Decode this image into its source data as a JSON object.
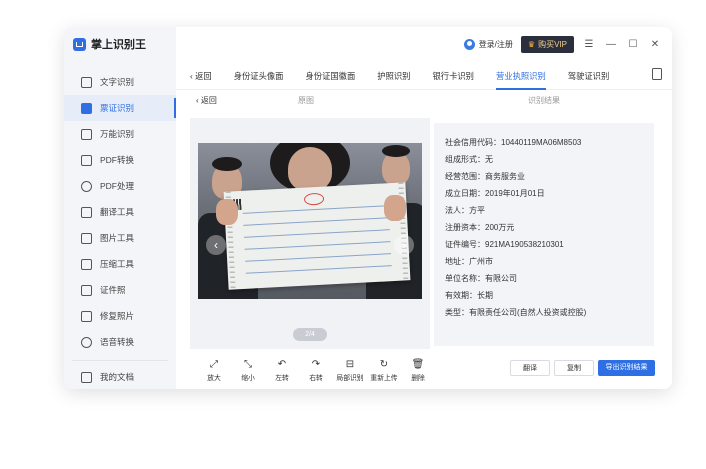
{
  "app": {
    "title": "掌上识别王"
  },
  "sidebar": {
    "items": [
      {
        "label": "文字识别",
        "icon": "text-doc-icon"
      },
      {
        "label": "票证识别",
        "icon": "card-icon"
      },
      {
        "label": "万能识别",
        "icon": "scan-icon"
      },
      {
        "label": "PDF转换",
        "icon": "pdf-convert-icon"
      },
      {
        "label": "PDF处理",
        "icon": "pdf-process-icon"
      },
      {
        "label": "翻译工具",
        "icon": "translate-icon"
      },
      {
        "label": "图片工具",
        "icon": "image-icon"
      },
      {
        "label": "压缩工具",
        "icon": "compress-icon"
      },
      {
        "label": "证件照",
        "icon": "id-photo-icon"
      },
      {
        "label": "修复照片",
        "icon": "repair-photo-icon"
      },
      {
        "label": "语音转换",
        "icon": "voice-icon"
      }
    ],
    "bottom": {
      "label": "我的文档",
      "icon": "my-docs-icon"
    }
  },
  "titlebar": {
    "login": "登录/注册",
    "vip": "购买VIP",
    "menu": "☰",
    "minimize": "—",
    "maximize": "☐",
    "close": "✕"
  },
  "tabs": {
    "back": "返回",
    "items": [
      "身份证头像面",
      "身份证国徽面",
      "护照识别",
      "银行卡识别",
      "营业执照识别",
      "驾驶证识别"
    ],
    "active_index": 4
  },
  "subheader": {
    "back": "返回",
    "original": "原图",
    "result": "识别结果"
  },
  "image": {
    "pager": "2/4",
    "prev": "‹",
    "next": "›"
  },
  "result": {
    "fields": [
      "社会信用代码：10440119MA06M8503",
      "组成形式：无",
      "经营范围：商务服务业",
      "成立日期：2019年01月01日",
      "法人：方平",
      "注册资本：200万元",
      "证件编号：921MA190538210301",
      "地址：广州市",
      "单位名称：有限公司",
      "有效期：长期",
      "类型：有限责任公司(自然人投资或控股)"
    ]
  },
  "toolbar": {
    "tools": [
      {
        "label": "放大",
        "glyph": "⤢",
        "icon": "zoom-in-icon"
      },
      {
        "label": "缩小",
        "glyph": "⤡",
        "icon": "zoom-out-icon"
      },
      {
        "label": "左转",
        "glyph": "↶",
        "icon": "rotate-left-icon"
      },
      {
        "label": "右转",
        "glyph": "↷",
        "icon": "rotate-right-icon"
      },
      {
        "label": "局部识别",
        "glyph": "⊟",
        "icon": "partial-recognize-icon"
      },
      {
        "label": "重新上传",
        "glyph": "↻",
        "icon": "reupload-icon"
      },
      {
        "label": "删除",
        "glyph": "🗑",
        "icon": "delete-icon"
      }
    ],
    "translate": "翻译",
    "copy": "复制",
    "export": "导出识别结果"
  },
  "colors": {
    "accent": "#2f6fe4",
    "vip_bg": "#2b2f3d",
    "vip_text": "#f3d08c"
  }
}
